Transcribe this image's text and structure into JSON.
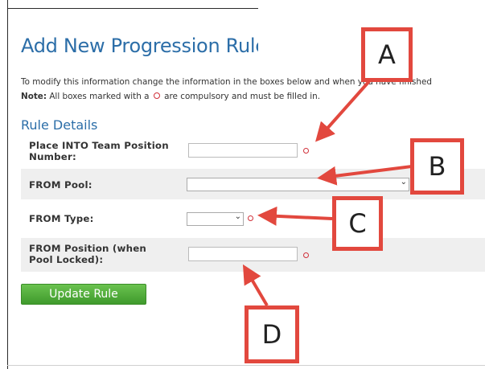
{
  "page": {
    "title": "Add New Progression Rule",
    "intro": "To modify this information change the information in the boxes below and when you have finished",
    "note_label": "Note:",
    "note_text_before": "All boxes marked with a",
    "note_text_after": "are compulsory and must be filled in."
  },
  "section": {
    "title": "Rule Details"
  },
  "fields": [
    {
      "label_line1": "Place INTO Team Position",
      "label_line2": "Number:",
      "type": "text",
      "value": "",
      "required": true
    },
    {
      "label_line1": "FROM Pool:",
      "label_line2": "",
      "type": "select",
      "value": "",
      "required": false
    },
    {
      "label_line1": "FROM Type:",
      "label_line2": "",
      "type": "select",
      "value": "",
      "required": true
    },
    {
      "label_line1": "FROM Position (when",
      "label_line2": "Pool Locked):",
      "type": "text",
      "value": "",
      "required": true
    }
  ],
  "actions": {
    "update_label": "Update Rule"
  },
  "annotations": [
    "A",
    "B",
    "C",
    "D"
  ],
  "colors": {
    "title": "#2c6ea8",
    "required_marker": "#d0303a",
    "button_green": "#4caf3a",
    "callout_red": "#e2483e"
  }
}
